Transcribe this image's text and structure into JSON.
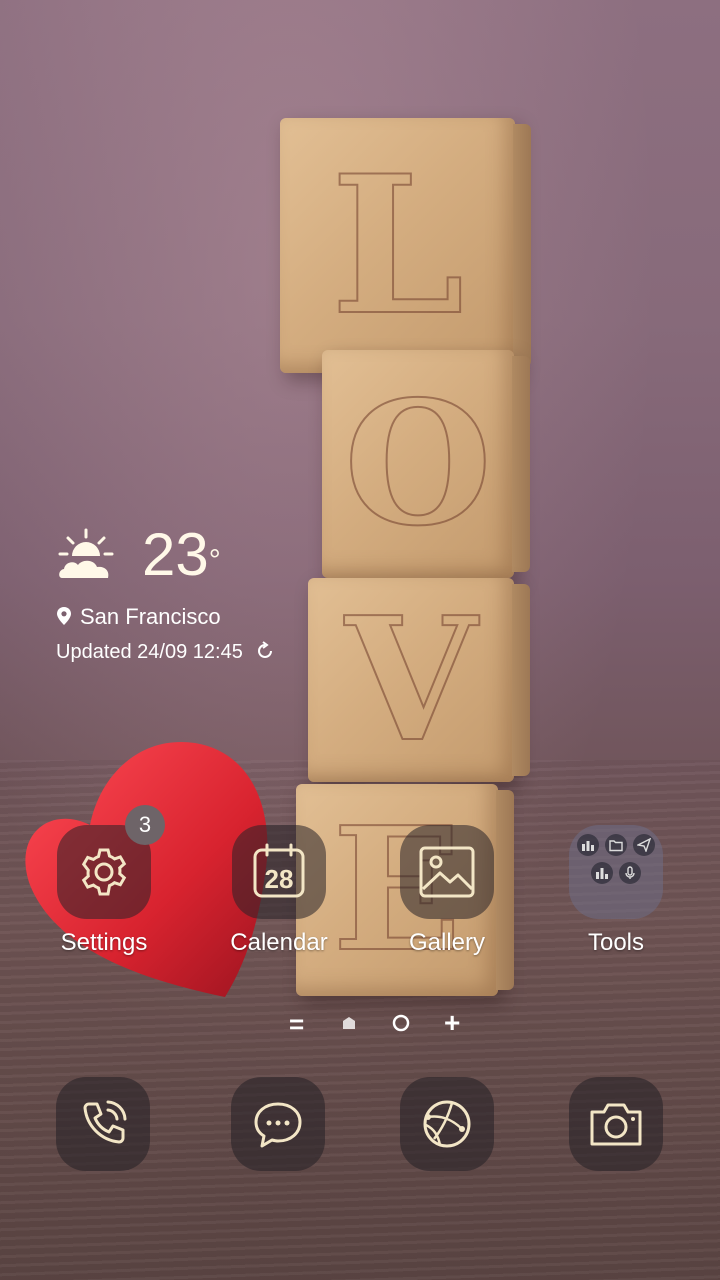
{
  "weather": {
    "temperature": "23",
    "degree_symbol": "°",
    "city": "San Francisco",
    "updated": "Updated 24/09 12:45",
    "icon": "partly-sunny-icon"
  },
  "home_apps": [
    {
      "label": "Settings",
      "icon": "gear-icon",
      "badge": "3"
    },
    {
      "label": "Calendar",
      "icon": "calendar-icon",
      "day": "28"
    },
    {
      "label": "Gallery",
      "icon": "image-icon"
    },
    {
      "label": "Tools",
      "icon": "folder-icon"
    }
  ],
  "pager": {
    "items": [
      "menu-indicator",
      "home-page",
      "page",
      "add-page"
    ],
    "symbols": {
      "menu": "=",
      "add": "+"
    }
  },
  "dock": [
    {
      "icon": "phone-icon"
    },
    {
      "icon": "messages-icon"
    },
    {
      "icon": "browser-icon"
    },
    {
      "icon": "camera-icon"
    }
  ],
  "wallpaper": {
    "letters": [
      "L",
      "O",
      "V",
      "E"
    ]
  },
  "colors": {
    "icon_stroke": "#f3e6c6",
    "tile_bg": "#2a2328",
    "heart": "#d8232f"
  }
}
